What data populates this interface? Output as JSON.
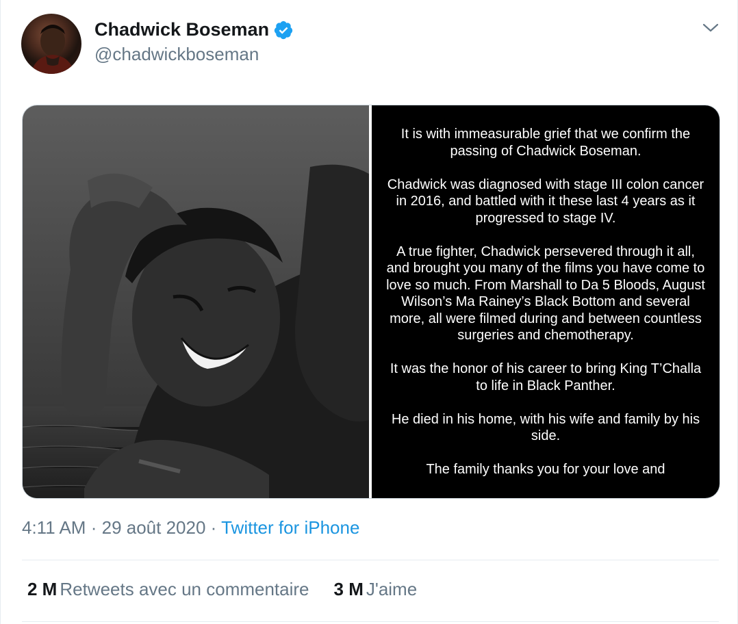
{
  "author": {
    "display_name": "Chadwick Boseman",
    "handle": "@chadwickboseman",
    "verified": true
  },
  "icons": {
    "verified": "verified-badge-icon",
    "caret": "chevron-down-icon"
  },
  "media": {
    "statement_paragraphs": [
      "It is with immeasurable grief that we confirm the passing of Chadwick Boseman.",
      "Chadwick was diagnosed with stage III colon cancer in 2016, and battled with it these last 4 years as it progressed to stage IV.",
      "A true fighter, Chadwick persevered through it all, and brought you many of the films you have come to love so much. From Marshall to Da 5 Bloods, August Wilson’s Ma Rainey’s Black Bottom and several more, all were filmed during and between countless surgeries and chemotherapy.",
      "It was the honor of his career to bring King T’Challa to life in Black Panther.",
      "He died in his home, with his wife and family by his side.",
      "The family thanks you for your love and"
    ]
  },
  "meta": {
    "time": "4:11 AM",
    "separator": "·",
    "date": "29 août 2020",
    "source": "Twitter for iPhone"
  },
  "stats": {
    "retweets_count": "2 M",
    "retweets_label": "Retweets avec un commentaire",
    "likes_count": "3 M",
    "likes_label": "J'aime"
  },
  "colors": {
    "accent": "#1b95e0",
    "verified": "#1da1f2",
    "secondary_text": "#657786",
    "primary_text": "#14171a",
    "divider": "#e6ecf0"
  }
}
